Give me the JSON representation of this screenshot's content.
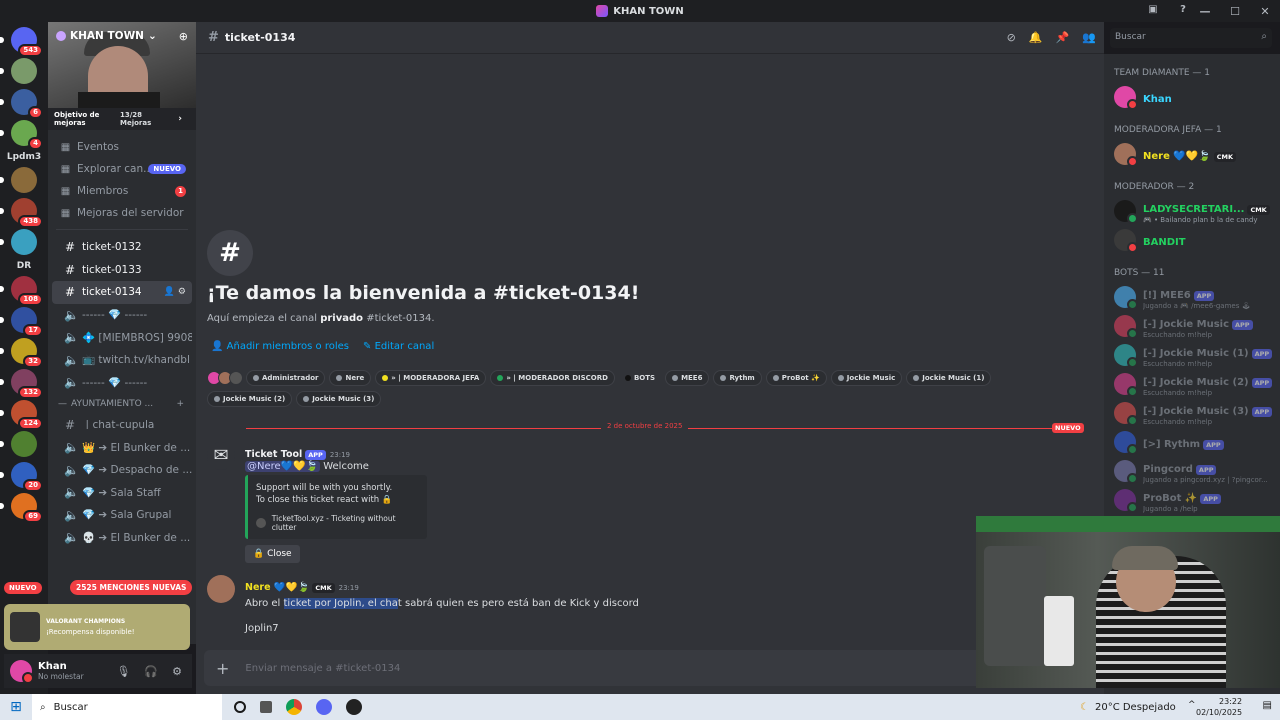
{
  "window": {
    "title": "KHAN TOWN"
  },
  "servers": [
    {
      "name": "discord-home",
      "badge": "543",
      "color": "#5865f2"
    },
    {
      "name": "server-2",
      "badge": "",
      "color": "#7a9a6a"
    },
    {
      "name": "server-3",
      "badge": "6",
      "color": "#3b5fa0"
    },
    {
      "name": "server-4",
      "badge": "4",
      "color": "#6aa84f"
    },
    {
      "name": "server-lpdm3",
      "text": "Lpdm3"
    },
    {
      "name": "server-6",
      "badge": "",
      "color": "#8a6a3a"
    },
    {
      "name": "server-7",
      "badge": "438",
      "color": "#a04030"
    },
    {
      "name": "server-8",
      "badge": "",
      "color": "#3aa0c0"
    },
    {
      "name": "server-dr",
      "text": "DR"
    },
    {
      "name": "server-10",
      "badge": "108",
      "color": "#a03040"
    },
    {
      "name": "server-11",
      "badge": "17",
      "color": "#3050a0"
    },
    {
      "name": "server-12",
      "badge": "32",
      "color": "#c0a020"
    },
    {
      "name": "server-13",
      "badge": "132",
      "color": "#804060"
    },
    {
      "name": "server-14",
      "badge": "124",
      "color": "#c05030"
    },
    {
      "name": "server-15",
      "badge": "",
      "color": "#508030"
    },
    {
      "name": "server-16",
      "badge": "20",
      "color": "#3060c0"
    },
    {
      "name": "server-17",
      "badge": "69",
      "color": "#e07020"
    }
  ],
  "server_new": "NUEVO",
  "guild": {
    "name": "KHAN TOWN",
    "boost_goal": "Objetivo de mejoras",
    "boost_count": "13/28",
    "boost_unit": "Mejoras"
  },
  "nav": [
    {
      "label": "Eventos",
      "icon": "calendar-icon"
    },
    {
      "label": "Explorar can...",
      "icon": "explore-icon",
      "tag": "NUEVO"
    },
    {
      "label": "Miembros",
      "icon": "members-icon",
      "count": "1"
    },
    {
      "label": "Mejoras del servidor",
      "icon": "boost-icon"
    }
  ],
  "channels": [
    {
      "label": "ticket-0132",
      "icon": "#",
      "bright": true
    },
    {
      "label": "ticket-0133",
      "icon": "#",
      "bright": true
    },
    {
      "label": "ticket-0134",
      "icon": "#",
      "active": true
    },
    {
      "label": "------ 💎 ------",
      "icon": "🔈"
    },
    {
      "label": "💠 [MIEMBROS] 9908",
      "icon": "🔈"
    },
    {
      "label": "📺 twitch.tv/khandbl",
      "icon": "🔈"
    },
    {
      "label": "------ 💎 ------",
      "icon": "🔈"
    }
  ],
  "category": "AYUNTAMIENTO ...",
  "channels2": [
    {
      "label": "〡chat-cupula",
      "icon": "#"
    },
    {
      "label": "👑 ➔ El Bunker de ...",
      "icon": "🔈"
    },
    {
      "label": "💎 ➔ Despacho de ...",
      "icon": "🔈"
    },
    {
      "label": "💎 ➔ Sala Staff",
      "icon": "🔈"
    },
    {
      "label": "💎 ➔ Sala Grupal",
      "icon": "🔈"
    },
    {
      "label": "💀 ➔ El Bunker de ...",
      "icon": "🔈"
    }
  ],
  "mentions": "2525 MENCIONES NUEVAS",
  "promo": {
    "title": "VALORANT CHAMPIONS",
    "text": "¡Recompensa disponible!"
  },
  "user": {
    "name": "Khan",
    "status": "No molestar"
  },
  "channel_header": {
    "name": "ticket-0134"
  },
  "search_placeholder": "Buscar",
  "welcome": {
    "title": "¡Te damos la bienvenida a #ticket-0134!",
    "sub_pre": "Aquí empieza el canal ",
    "sub_bold": "privado",
    "sub_post": " #ticket-0134.",
    "add_members": "Añadir miembros o roles",
    "edit_channel": "Editar canal"
  },
  "roles": [
    {
      "label": "Administrador",
      "color": "#949ba4"
    },
    {
      "label": "Nere",
      "color": "#949ba4"
    },
    {
      "label": "» | MODERADORA JEFA",
      "color": "#f0e020"
    },
    {
      "label": "» | MODERADOR DISCORD",
      "color": "#23a55a"
    },
    {
      "label": "BOTS",
      "color": "#111111",
      "plain": true
    },
    {
      "label": "MEE6",
      "color": "#949ba4"
    },
    {
      "label": "Rythm",
      "color": "#949ba4"
    },
    {
      "label": "ProBot ✨",
      "color": "#949ba4"
    },
    {
      "label": "Jockie Music",
      "color": "#949ba4"
    },
    {
      "label": "Jockie Music (1)",
      "color": "#949ba4"
    },
    {
      "label": "Jockie Music (2)",
      "color": "#949ba4"
    },
    {
      "label": "Jockie Music (3)",
      "color": "#949ba4"
    }
  ],
  "divider": {
    "date": "2 de octubre de 2025",
    "tag": "NUEVO"
  },
  "msg1": {
    "author": "Ticket Tool",
    "tag": "APP",
    "time": "23:19",
    "mention": "@Nere💙💛🍃",
    "text": " Welcome",
    "embed_line1": "Support will be with you shortly.",
    "embed_line2": "To close this ticket react with 🔒",
    "embed_footer": "TicketTool.xyz - Ticketing without clutter",
    "button": "🔒 Close"
  },
  "msg2": {
    "author": "Nere 💙💛🍃",
    "tag": "CMK",
    "time": "23:19",
    "text_a": "Abro el ",
    "text_hl": "ticket por Joplin, el cha",
    "text_b": "t sabrá quien es pero está ban de Kick y discord",
    "text2": "Joplin7"
  },
  "composer": {
    "placeholder": "Enviar mensaje a #ticket-0134"
  },
  "member_groups": [
    {
      "title": "TEAM DIAMANTE — 1",
      "members": [
        {
          "name": "Khan",
          "color": "#3ad6ff",
          "av": "#e048a6",
          "status": "#f23f43"
        }
      ]
    },
    {
      "title": "MODERADORA JEFA — 1",
      "members": [
        {
          "name": "Nere 💙💛🍃",
          "color": "#f0e020",
          "av": "#a0705a",
          "tag": "CMK",
          "status": "#f23f43"
        }
      ]
    },
    {
      "title": "MODERADOR — 2",
      "members": [
        {
          "name": "LADYSECRETARI...",
          "color": "#23d160",
          "av": "#1a1a1a",
          "tag": "CMK",
          "sub": "🎮 • Bailando plan b la de candy"
        },
        {
          "name": "BANDIT",
          "color": "#23d160",
          "av": "#3a3a3a",
          "status": "#f23f43"
        }
      ]
    },
    {
      "title": "BOTS — 11",
      "members": [
        {
          "name": "[!] MEE6",
          "color": "#949ba4",
          "av": "#4fb7ff",
          "tag": "APP",
          "sub": "Jugando a 🎮 /mee6-games 🕹",
          "dim": true
        },
        {
          "name": "[-] Jockie Music",
          "color": "#949ba4",
          "av": "#e04060",
          "tag": "APP",
          "sub": "Escuchando m!help",
          "dim": true
        },
        {
          "name": "[-] Jockie Music (1)",
          "color": "#949ba4",
          "av": "#30c0c0",
          "tag": "APP",
          "sub": "Escuchando m!help",
          "dim": true
        },
        {
          "name": "[-] Jockie Music (2)",
          "color": "#949ba4",
          "av": "#e04090",
          "tag": "APP",
          "sub": "Escuchando m!help",
          "dim": true
        },
        {
          "name": "[-] Jockie Music (3)",
          "color": "#949ba4",
          "av": "#e05050",
          "tag": "APP",
          "sub": "Escuchando m!help",
          "dim": true
        },
        {
          "name": "[>] Rythm",
          "color": "#949ba4",
          "av": "#3060e0",
          "tag": "APP",
          "dim": true
        },
        {
          "name": "Pingcord",
          "color": "#949ba4",
          "av": "#7a7ab0",
          "tag": "APP",
          "sub": "Jugando a pingcord.xyz | ?pingcor...",
          "dim": true
        },
        {
          "name": "ProBot ✨",
          "color": "#949ba4",
          "av": "#8030a0",
          "tag": "APP",
          "sub": "Jugando a /help",
          "dim": true
        }
      ]
    }
  ],
  "taskbar": {
    "search": "Buscar",
    "weather": "20°C  Despejado",
    "time": "23:22",
    "date": "02/10/2025"
  }
}
